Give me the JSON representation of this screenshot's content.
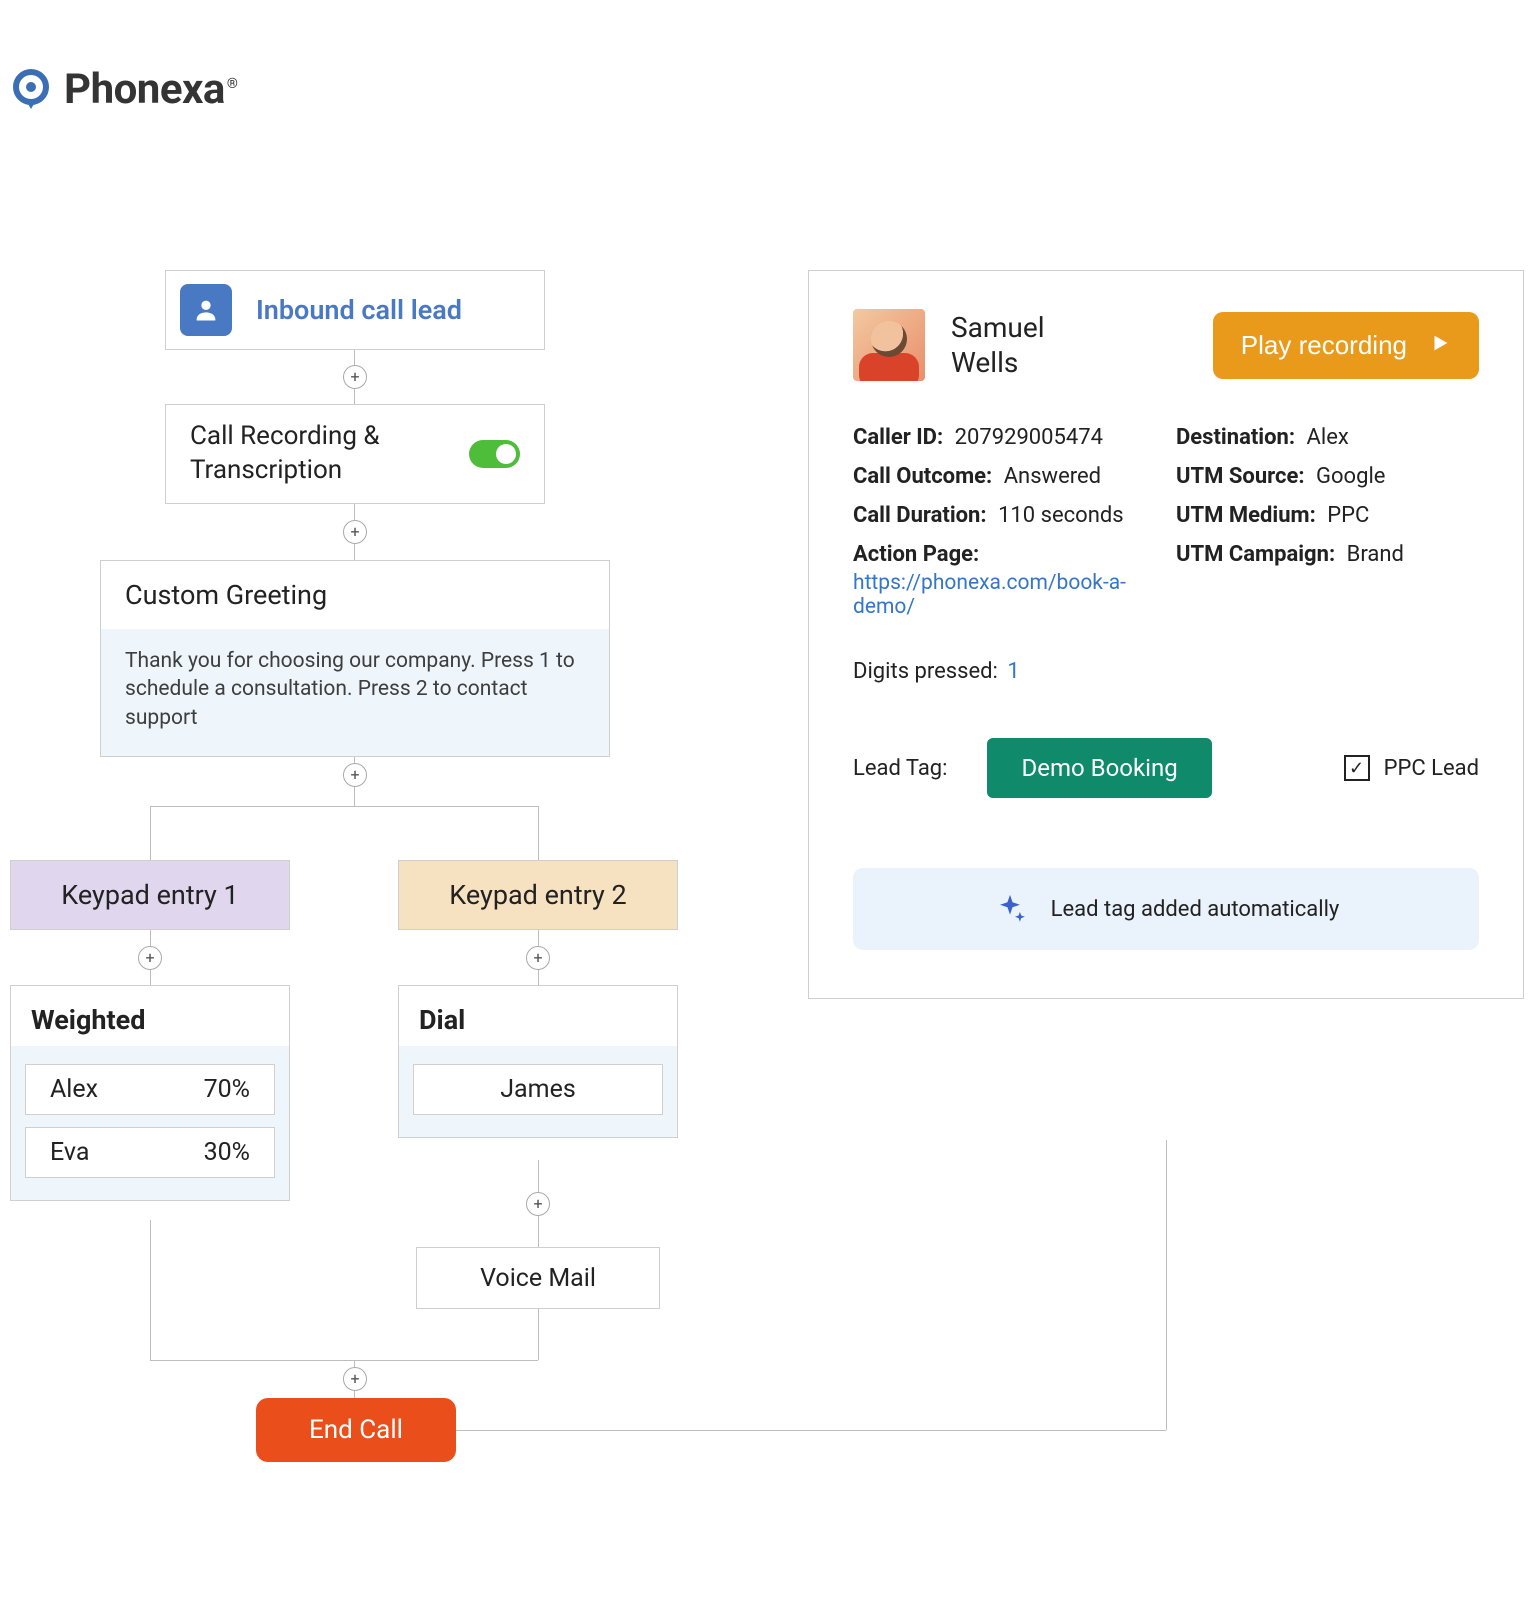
{
  "brand": {
    "name": "Phonexa"
  },
  "flow": {
    "inbound_title": "Inbound call lead",
    "recording_title": "Call Recording & Transcription",
    "greeting_title": "Custom Greeting",
    "greeting_body": "Thank you for choosing our company. Press 1 to schedule a consultation. Press 2 to contact support",
    "keypad1": "Keypad entry 1",
    "keypad2": "Keypad entry 2",
    "weighted_title": "Weighted",
    "weighted_rows": [
      {
        "name": "Alex",
        "pct": "70%"
      },
      {
        "name": "Eva",
        "pct": "30%"
      }
    ],
    "dial_title": "Dial",
    "dial_name": "James",
    "voicemail": "Voice Mail",
    "end_call": "End Call"
  },
  "card": {
    "caller_first": "Samuel",
    "caller_last": "Wells",
    "play_label": "Play recording",
    "caller_id_label": "Caller ID:",
    "caller_id": "207929005474",
    "outcome_label": "Call Outcome:",
    "outcome": "Answered",
    "duration_label": "Call Duration:",
    "duration": "110 seconds",
    "action_label": "Action Page:",
    "action_url": "https://phonexa.com/book-a-demo/",
    "dest_label": "Destination:",
    "dest": "Alex",
    "utm_src_label": "UTM Source:",
    "utm_src": "Google",
    "utm_med_label": "UTM Medium:",
    "utm_med": "PPC",
    "utm_cmp_label": "UTM Campaign:",
    "utm_cmp": "Brand",
    "digits_label": "Digits pressed:",
    "digits_val": "1",
    "lead_tag_label": "Lead Tag:",
    "tag_pill": "Demo Booking",
    "ppc_label": "PPC Lead",
    "auto_banner": "Lead tag added automatically"
  }
}
